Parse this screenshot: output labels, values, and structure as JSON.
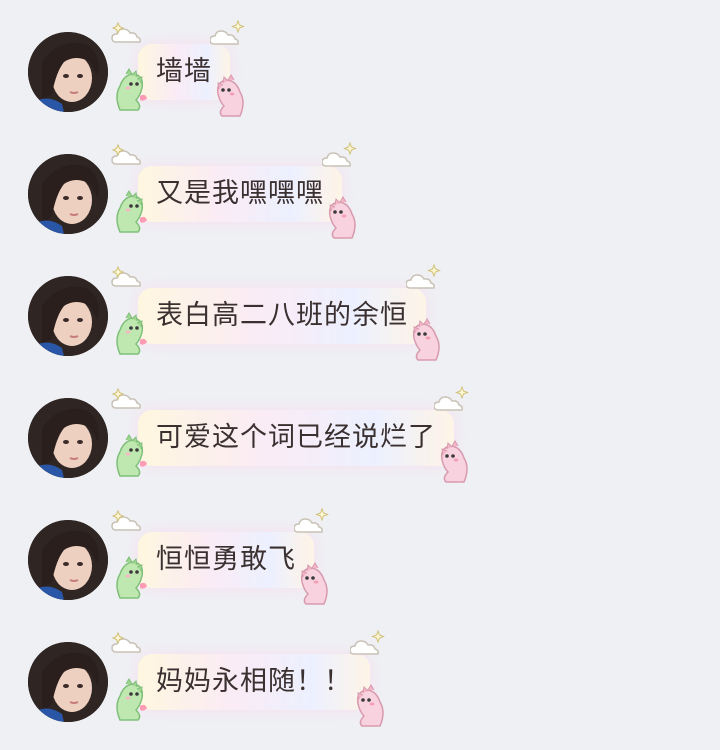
{
  "chat": {
    "messages": [
      {
        "text": "墙墙"
      },
      {
        "text": "又是我嘿嘿嘿"
      },
      {
        "text": "表白高二八班的余恒"
      },
      {
        "text": "可爱这个词已经说烂了"
      },
      {
        "text": "恒恒勇敢飞"
      },
      {
        "text": "妈妈永相随！！"
      }
    ]
  },
  "colors": {
    "background": "#eff0f4",
    "text": "#3a3030",
    "dino_green": "#b8e6a8",
    "dino_pink": "#f6c6d6"
  },
  "icons": [
    "avatar",
    "cloud-star-icon",
    "green-dinosaur-icon",
    "pink-dinosaur-icon"
  ]
}
